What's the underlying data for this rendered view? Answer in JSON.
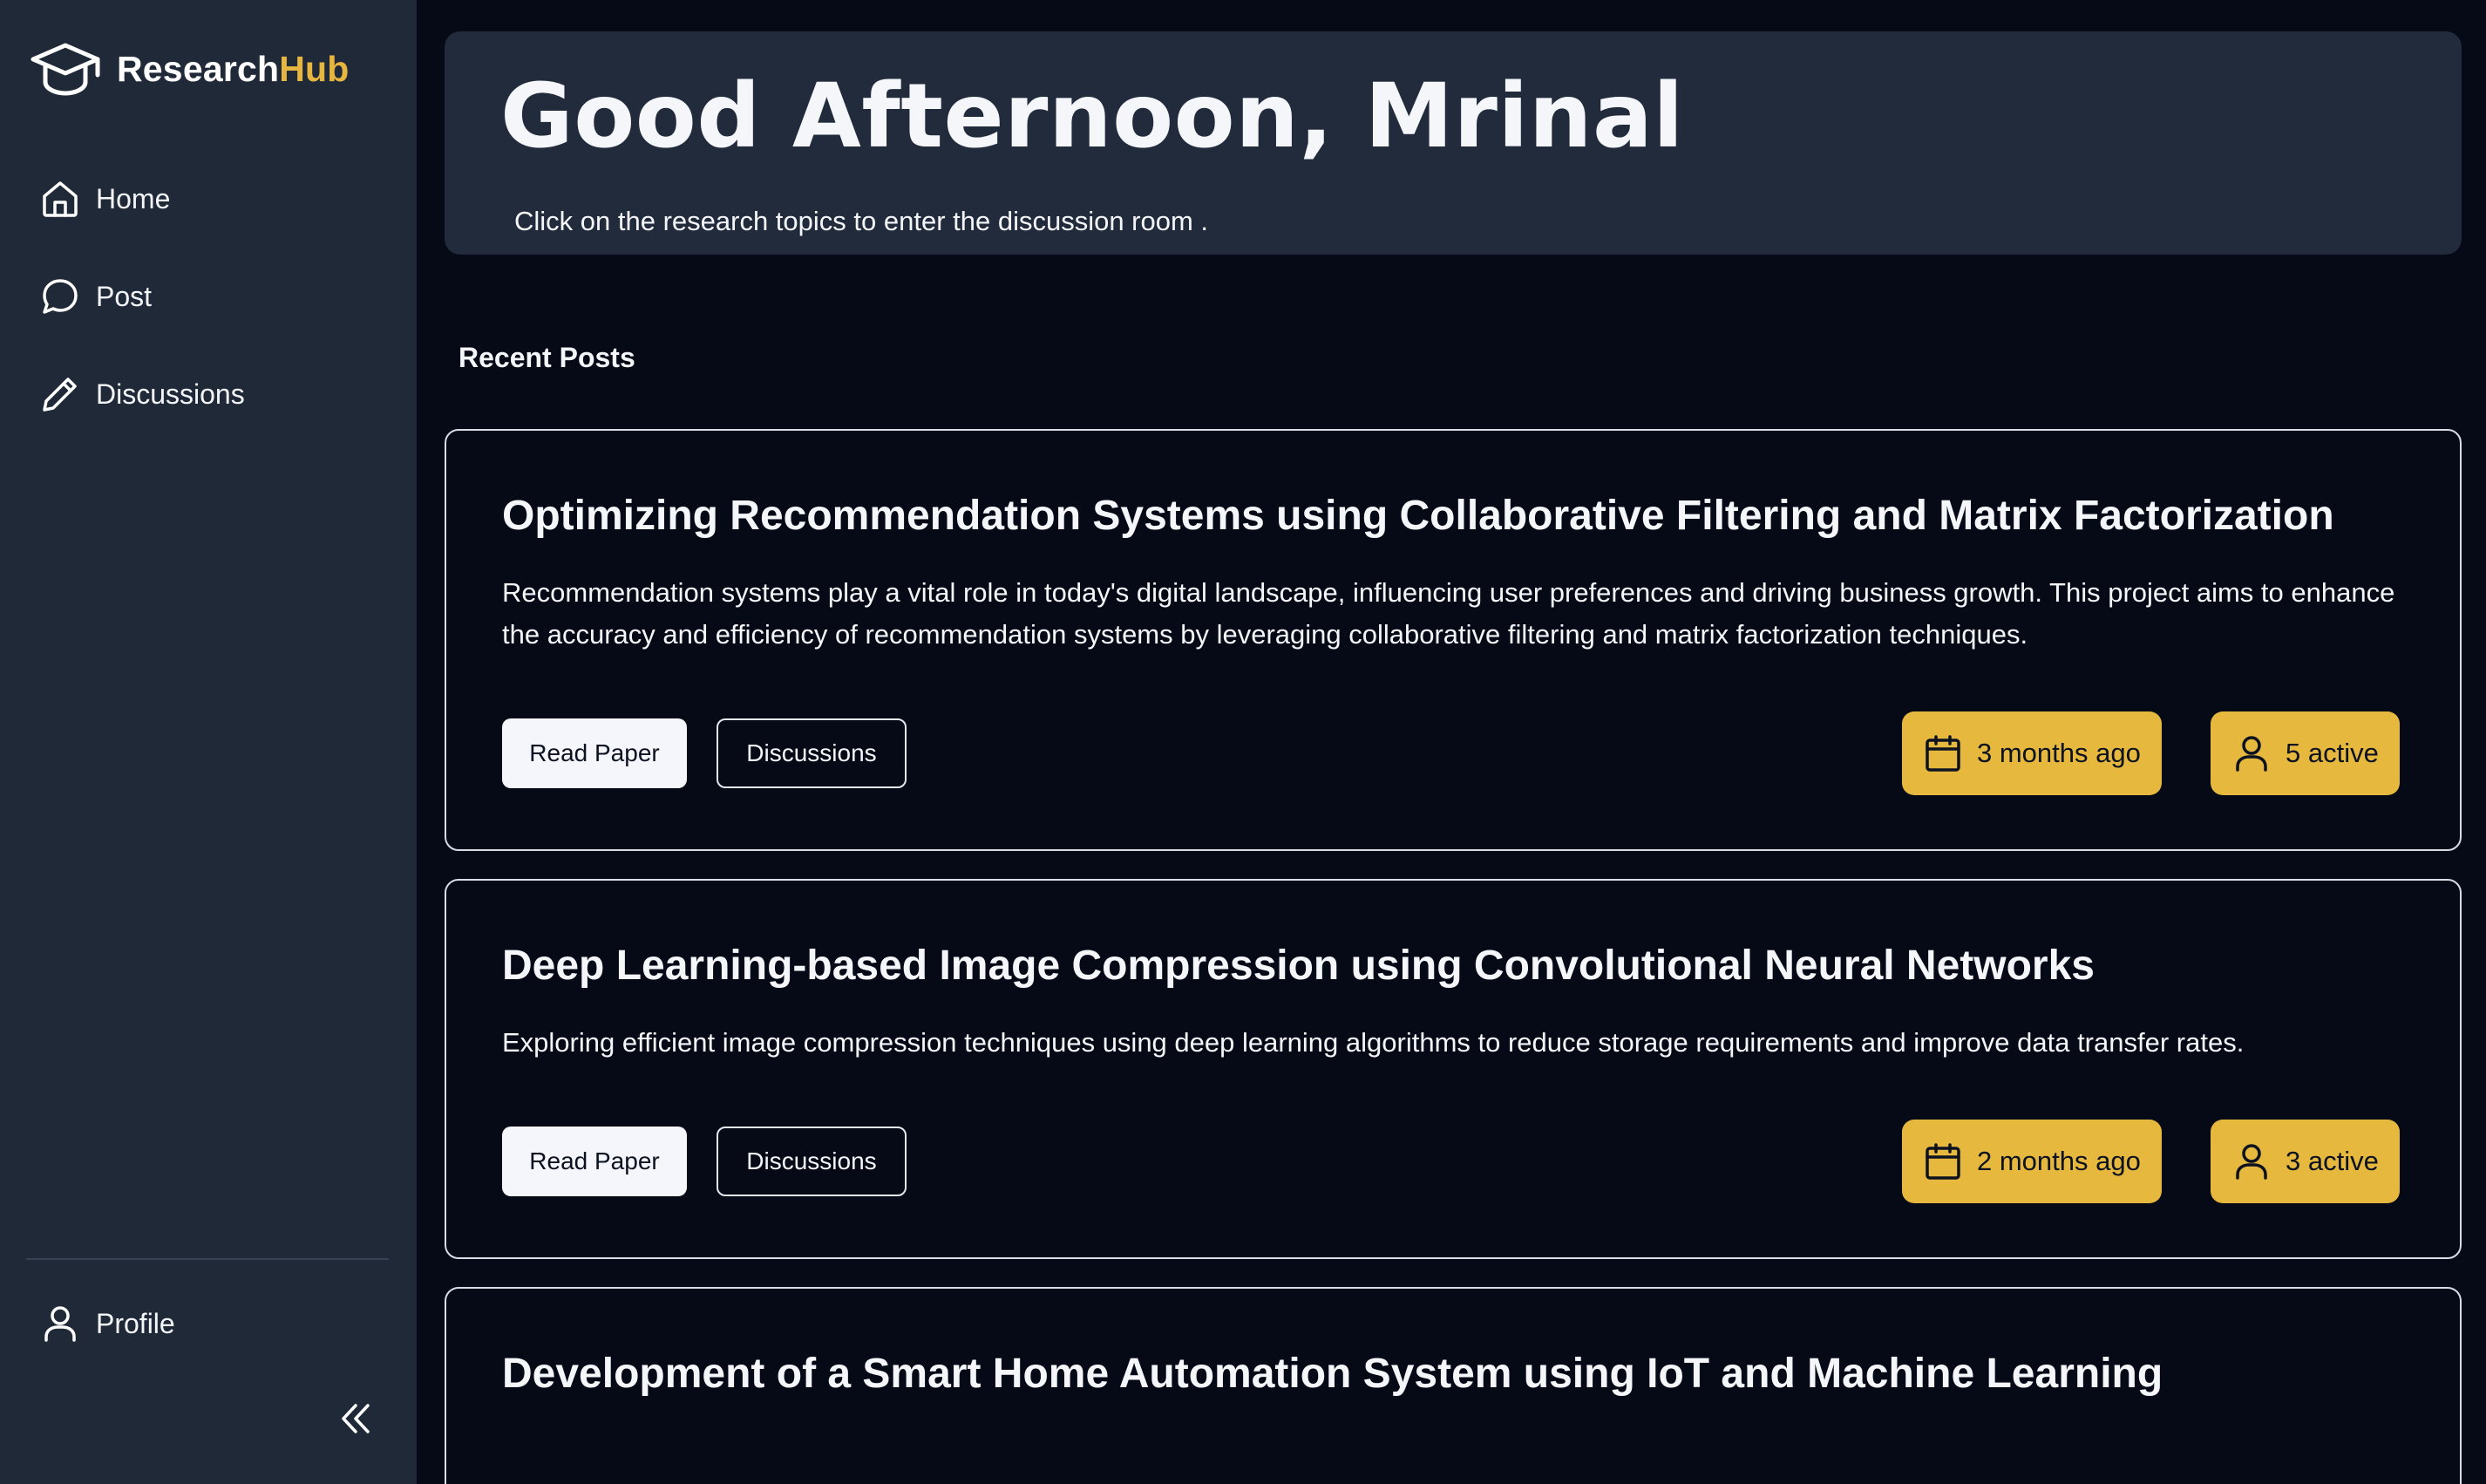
{
  "brand": {
    "name_part1": "Research",
    "name_part2": "Hub",
    "accent": "#e6b640",
    "icon": "graduation-cap-icon"
  },
  "sidebar": {
    "items": [
      {
        "label": "Home",
        "icon": "home-icon"
      },
      {
        "label": "Post",
        "icon": "message-circle-icon"
      },
      {
        "label": "Discussions",
        "icon": "pencil-icon"
      }
    ],
    "profile": {
      "label": "Profile",
      "icon": "user-icon"
    },
    "collapse_icon": "chevrons-left-icon"
  },
  "hero": {
    "title": "Good Afternoon, Mrinal",
    "subtitle": "Click on the research topics to enter the discussion room ."
  },
  "recent": {
    "heading": "Recent Posts",
    "posts": [
      {
        "title": "Optimizing Recommendation Systems using Collaborative Filtering and Matrix Factorization",
        "description": "Recommendation systems play a vital role in today's digital landscape, influencing user preferences and driving business growth. This project aims to enhance the accuracy and efficiency of recommendation systems by leveraging collaborative filtering and matrix factorization techniques.",
        "read_label": "Read Paper",
        "discuss_label": "Discussions",
        "time": "3 months ago",
        "active": "5 active"
      },
      {
        "title": "Deep Learning-based Image Compression using Convolutional Neural Networks",
        "description": "Exploring efficient image compression techniques using deep learning algorithms to reduce storage requirements and improve data transfer rates.",
        "read_label": "Read Paper",
        "discuss_label": "Discussions",
        "time": "2 months ago",
        "active": "3 active"
      },
      {
        "title": "Development of a Smart Home Automation System using IoT and Machine Learning"
      }
    ]
  },
  "colors": {
    "sidebar_bg": "#1f2938",
    "page_bg": "#050a16",
    "badge_bg": "#e6b83e"
  }
}
